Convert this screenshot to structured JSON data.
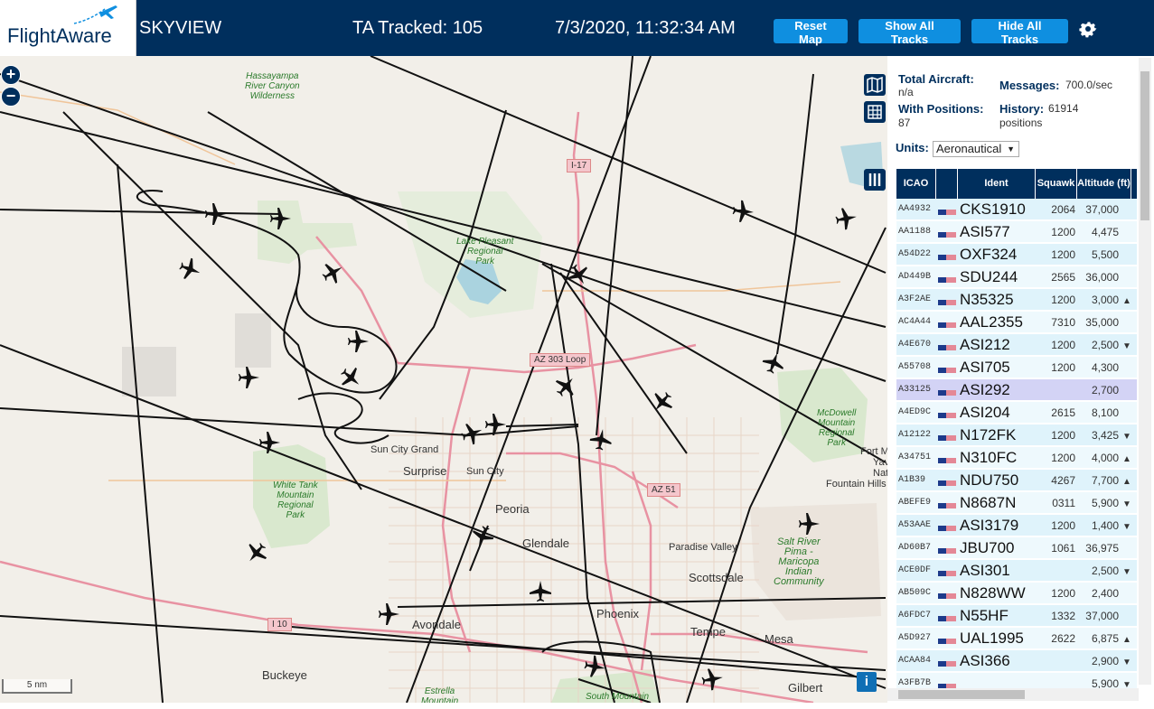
{
  "header": {
    "logo_text": "FlightAware",
    "app_title": "SKYVIEW",
    "tracked_label": "TA Tracked: 105",
    "datetime": "7/3/2020, 11:32:34 AM",
    "buttons": {
      "reset_map": "Reset Map",
      "show_tracks": "Show All Tracks",
      "hide_tracks": "Hide All Tracks"
    },
    "brand_color": "#002f5d",
    "button_color": "#0f8fe0"
  },
  "map": {
    "zoom_in": "+",
    "zoom_out": "−",
    "scale_label": "5 nm",
    "info_label": "i",
    "city_labels": [
      "Surprise",
      "Sun City",
      "Sun City Grand",
      "Peoria",
      "Glendale",
      "Paradise Valley",
      "Scottsdale",
      "Phoenix",
      "Avondale",
      "Tempe",
      "Mesa",
      "Buckeye",
      "Fountain Hills",
      "Gilbert",
      "Fort M",
      "Yav",
      "Nat",
      "Pa"
    ],
    "park_labels": [
      "Hassayampa River Canyon Wilderness",
      "Lake Pleasant Regional Park",
      "White Tank Mountain Regional Park",
      "McDowell Mountain Regional Park",
      "Salt River Pima - Maricopa Indian Community",
      "Estrella Mountain",
      "South Mountain"
    ],
    "road_shields": [
      "I-17",
      "AZ 303 Loop",
      "AZ 51",
      "I 10"
    ]
  },
  "panel": {
    "total_aircraft_label": "Total Aircraft:",
    "total_aircraft_value": "n/a",
    "messages_label": "Messages:",
    "messages_value": "700.0/sec",
    "with_positions_label": "With Positions:",
    "with_positions_value": "87",
    "history_label": "History:",
    "history_value": "61914",
    "history_unit": "positions",
    "units_label": "Units:",
    "units_value": "Aeronautical",
    "columns": [
      "ICAO",
      "",
      "Ident",
      "Squawk",
      "Altitude (ft)"
    ],
    "rows": [
      {
        "icao": "AA4932",
        "ident": "CKS1910",
        "squawk": "2064",
        "alt": "37,000",
        "trend": ""
      },
      {
        "icao": "AA1188",
        "ident": "ASI577",
        "squawk": "1200",
        "alt": "4,475",
        "trend": ""
      },
      {
        "icao": "A54D22",
        "ident": "OXF324",
        "squawk": "1200",
        "alt": "5,500",
        "trend": ""
      },
      {
        "icao": "AD449B",
        "ident": "SDU244",
        "squawk": "2565",
        "alt": "36,000",
        "trend": ""
      },
      {
        "icao": "A3F2AE",
        "ident": "N35325",
        "squawk": "1200",
        "alt": "3,000",
        "trend": "▲"
      },
      {
        "icao": "AC4A44",
        "ident": "AAL2355",
        "squawk": "7310",
        "alt": "35,000",
        "trend": ""
      },
      {
        "icao": "A4E670",
        "ident": "ASI212",
        "squawk": "1200",
        "alt": "2,500",
        "trend": "▼"
      },
      {
        "icao": "A55708",
        "ident": "ASI705",
        "squawk": "1200",
        "alt": "4,300",
        "trend": ""
      },
      {
        "icao": "A33125",
        "ident": "ASI292",
        "squawk": "",
        "alt": "2,700",
        "trend": ""
      },
      {
        "icao": "A4ED9C",
        "ident": "ASI204",
        "squawk": "2615",
        "alt": "8,100",
        "trend": ""
      },
      {
        "icao": "A12122",
        "ident": "N172FK",
        "squawk": "1200",
        "alt": "3,425",
        "trend": "▼"
      },
      {
        "icao": "A34751",
        "ident": "N310FC",
        "squawk": "1200",
        "alt": "4,000",
        "trend": "▲"
      },
      {
        "icao": "A1B39",
        "ident": "NDU750",
        "squawk": "4267",
        "alt": "7,700",
        "trend": "▲"
      },
      {
        "icao": "ABEFE9",
        "ident": "N8687N",
        "squawk": "0311",
        "alt": "5,900",
        "trend": "▼"
      },
      {
        "icao": "A53AAE",
        "ident": "ASI3179",
        "squawk": "1200",
        "alt": "1,400",
        "trend": "▼"
      },
      {
        "icao": "AD60B7",
        "ident": "JBU700",
        "squawk": "1061",
        "alt": "36,975",
        "trend": ""
      },
      {
        "icao": "ACE0DF",
        "ident": "ASI301",
        "squawk": "",
        "alt": "2,500",
        "trend": "▼"
      },
      {
        "icao": "AB509C",
        "ident": "N828WW",
        "squawk": "1200",
        "alt": "2,400",
        "trend": ""
      },
      {
        "icao": "A6FDC7",
        "ident": "N55HF",
        "squawk": "1332",
        "alt": "37,000",
        "trend": ""
      },
      {
        "icao": "A5D927",
        "ident": "UAL1995",
        "squawk": "2622",
        "alt": "6,875",
        "trend": "▲"
      },
      {
        "icao": "ACAA84",
        "ident": "ASI366",
        "squawk": "",
        "alt": "2,900",
        "trend": "▼"
      },
      {
        "icao": "A3FB7B",
        "ident": "",
        "squawk": "",
        "alt": "5,900",
        "trend": "▼"
      }
    ],
    "selected_row_index": 8,
    "row_colors": {
      "even": "#dff3fb",
      "odd": "#eef9fd",
      "selected": "#d3d3f5"
    }
  }
}
